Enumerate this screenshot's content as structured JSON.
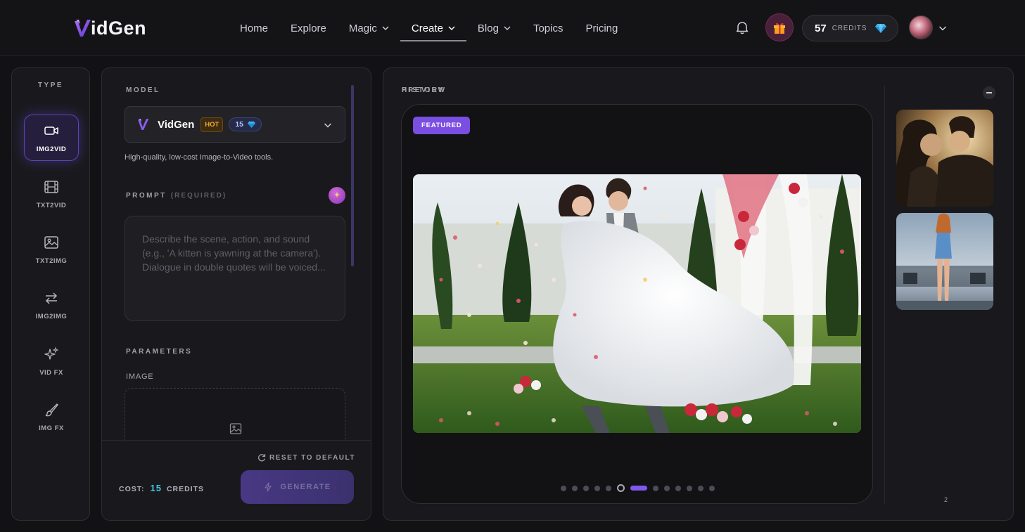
{
  "app": {
    "brand": "VidGen",
    "brand_letter": "idGen"
  },
  "nav": {
    "links": [
      {
        "label": "Home"
      },
      {
        "label": "Explore"
      },
      {
        "label": "Magic",
        "has_menu": true
      },
      {
        "label": "Create",
        "has_menu": true,
        "active": true
      },
      {
        "label": "Blog",
        "has_menu": true
      },
      {
        "label": "Topics"
      },
      {
        "label": "Pricing"
      }
    ],
    "credits": {
      "value": "57",
      "label": "CREDITS"
    },
    "icons": [
      "bell-icon",
      "gift-icon",
      "diamond-icon",
      "avatar",
      "chevron-down-icon"
    ]
  },
  "type_column": {
    "title": "TYPE",
    "items": [
      {
        "label": "IMG2VID",
        "icon": "video-camera-icon",
        "active": true
      },
      {
        "label": "TXT2VID",
        "icon": "film-icon"
      },
      {
        "label": "TXT2IMG",
        "icon": "image-icon"
      },
      {
        "label": "IMG2IMG",
        "icon": "swap-arrows-icon"
      },
      {
        "label": "VID FX",
        "icon": "sparkles-icon"
      },
      {
        "label": "IMG FX",
        "icon": "brush-icon"
      }
    ]
  },
  "form": {
    "model_title": "MODEL",
    "model": {
      "name": "VidGen",
      "hot_badge": "HOT",
      "cost": "15",
      "description": "High-quality, low-cost Image-to-Video tools."
    },
    "prompt_title": "PROMPT",
    "prompt_required": "(REQUIRED)",
    "prompt_placeholder": "Describe the scene, action, and sound (e.g., 'A kitten is yawning at the camera'). Dialogue in double quotes will be voiced...",
    "prompt_value": "",
    "parameters_title": "PARAMETERS",
    "image_label": "IMAGE",
    "reset_label": "RESET TO DEFAULT",
    "cost_label": "COST:",
    "cost_value": "15",
    "cost_unit": "CREDITS",
    "generate_label": "GENERATE"
  },
  "preview": {
    "title": "PREVIEW",
    "featured_label": "FEATURED",
    "media_description_icon": "wedding-video-preview",
    "dots_total": 13,
    "dots_active_index": 6,
    "dots_ring_index": 5
  },
  "history": {
    "title": "HISTORY",
    "page": "2",
    "items": [
      {
        "icon": "history-thumb-couple"
      },
      {
        "icon": "history-thumb-model"
      }
    ]
  },
  "colors": {
    "accent": "#7a4ee0",
    "cost_accent": "#43c6e8",
    "hot": "#f2a93b",
    "background": "#121215",
    "panel": "#19191d"
  }
}
